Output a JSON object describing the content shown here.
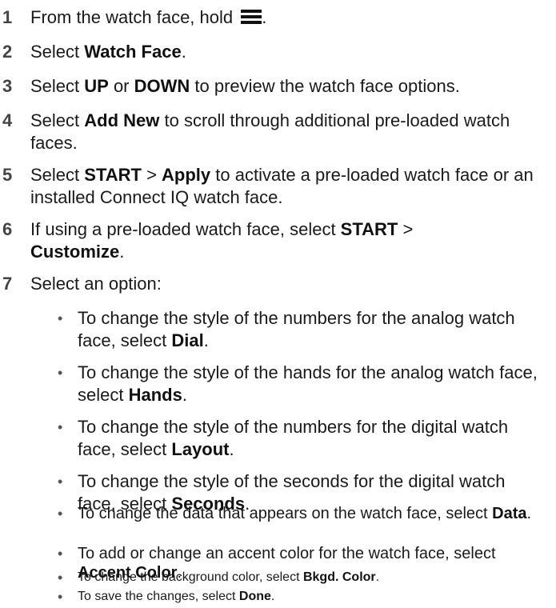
{
  "steps": [
    {
      "num": "1",
      "pre": "From the watch face, hold ",
      "icon": "menu-icon",
      "post": "."
    },
    {
      "num": "2",
      "pre": "Select ",
      "b1": "Watch Face",
      "post": "."
    },
    {
      "num": "3",
      "pre": "Select ",
      "b1": "UP",
      "mid": " or ",
      "b2": "DOWN",
      "post": " to preview the watch face options."
    },
    {
      "num": "4",
      "pre": "Select ",
      "b1": "Add New",
      "post": " to scroll through additional pre-loaded watch faces."
    },
    {
      "num": "5",
      "pre": "Select ",
      "b1": "START",
      "mid": " > ",
      "b2": "Apply",
      "post": " to activate a pre-loaded watch face or an installed Connect IQ watch face."
    },
    {
      "num": "6",
      "pre": "If using a pre-loaded watch face, select ",
      "b1": "START",
      "mid": " > ",
      "b2": "Customize",
      "post": "."
    },
    {
      "num": "7",
      "pre": "Select an option:"
    }
  ],
  "bullets": [
    {
      "pre": "To change the style of the numbers for the analog watch face, select ",
      "b": "Dial",
      "post": "."
    },
    {
      "pre": "To change the style of the hands for the analog watch face, select ",
      "b": "Hands",
      "post": "."
    },
    {
      "pre": "To change the style of the numbers for the digital watch face, select ",
      "b": "Layout",
      "post": "."
    },
    {
      "pre": "To change the style of the seconds for the digital watch face, select ",
      "b": "Seconds",
      "post": "."
    },
    {
      "pre": "To change the data that appears on the watch face, select ",
      "b": "Data",
      "post": "."
    },
    {
      "pre": "To add or change an accent color for the watch face, select ",
      "b": "Accent Color",
      "post": "."
    },
    {
      "pre": "To change the background color, select ",
      "b": "Bkgd. Color",
      "post": "."
    },
    {
      "pre": "To save the changes, select ",
      "b": "Done",
      "post": "."
    }
  ],
  "bullet_glyph": "•"
}
